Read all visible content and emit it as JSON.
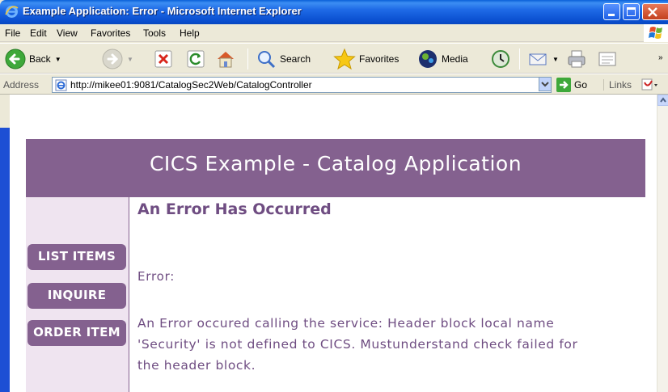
{
  "window": {
    "title": "Example Application: Error - Microsoft Internet Explorer"
  },
  "menu": [
    "File",
    "Edit",
    "View",
    "Favorites",
    "Tools",
    "Help"
  ],
  "toolbar": {
    "back": "Back",
    "search": "Search",
    "favorites": "Favorites",
    "media": "Media"
  },
  "address": {
    "label": "Address",
    "url": "http://mikee01:9081/CatalogSec2Web/CatalogController",
    "go": "Go",
    "links": "Links"
  },
  "page": {
    "header": "CICS Example - Catalog Application",
    "title": "An Error Has Occurred",
    "nav": [
      "LIST ITEMS",
      "INQUIRE",
      "ORDER ITEM"
    ],
    "error_label": "Error:",
    "error_lines": [
      "An Error occured calling the service: Header block local name",
      "'Security' is not defined to CICS. Mustunderstand check failed for",
      "the header block."
    ]
  },
  "colors": {
    "brand": "#84618f",
    "sidebar": "#efe4f0",
    "text": "#6f4d82"
  }
}
